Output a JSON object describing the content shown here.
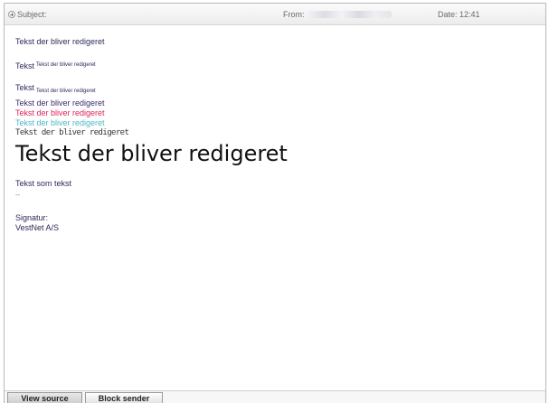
{
  "header": {
    "subject_label": "Subject:",
    "from_label": "From:",
    "date_label": "Date: 12:41"
  },
  "body": {
    "line1": "Tekst der bliver redigeret",
    "line2_big": "Tekst",
    "line2_small": "Tekst der bliver redigeret",
    "line3_big": "Tekst",
    "line3_small": "Tekst der bliver redigeret",
    "line4": "Tekst der bliver redigeret",
    "line5": "Tekst der bliver redigeret",
    "line6": "Tekst der bliver redigeret",
    "line7": "Tekst der bliver redigeret",
    "line8": "Tekst der bliver redigeret",
    "line9": "Tekst som tekst",
    "separator": "--",
    "signature_label": "Signatur:",
    "signature_company": "VestNet A/S"
  },
  "colors": {
    "default_text": "#2b2b5a",
    "pink": "#e0205a",
    "cyan": "#4cb8c8"
  },
  "footer": {
    "view_source": "View source",
    "block_sender": "Block sender"
  }
}
